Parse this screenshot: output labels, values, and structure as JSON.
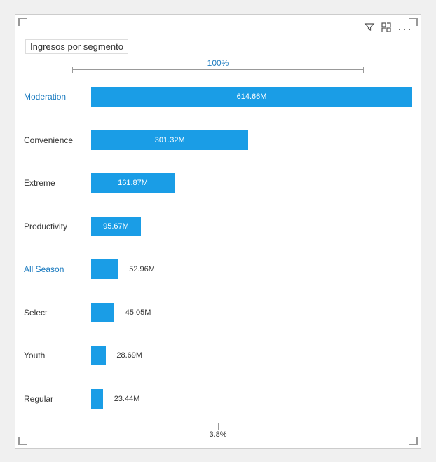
{
  "card": {
    "title": "Ingresos por segmento",
    "top_percent": "100%",
    "bottom_percent": "3.8%",
    "toolbar": {
      "filter_icon": "⊲",
      "expand_icon": "⤢",
      "more_icon": "···"
    },
    "rows": [
      {
        "label": "Moderation",
        "value": "614.66M",
        "highlight": true,
        "bar_pct": 100,
        "inside": true
      },
      {
        "label": "Convenience",
        "value": "301.32M",
        "highlight": false,
        "bar_pct": 49,
        "inside": true
      },
      {
        "label": "Extreme",
        "value": "161.87M",
        "highlight": false,
        "bar_pct": 26,
        "inside": true
      },
      {
        "label": "Productivity",
        "value": "95.67M",
        "highlight": false,
        "bar_pct": 15.5,
        "inside": true
      },
      {
        "label": "All Season",
        "value": "52.96M",
        "highlight": true,
        "bar_pct": 8.5,
        "inside": false
      },
      {
        "label": "Select",
        "value": "45.05M",
        "highlight": false,
        "bar_pct": 7.3,
        "inside": false
      },
      {
        "label": "Youth",
        "value": "28.69M",
        "highlight": false,
        "bar_pct": 4.6,
        "inside": false
      },
      {
        "label": "Regular",
        "value": "23.44M",
        "highlight": false,
        "bar_pct": 3.8,
        "inside": false
      }
    ]
  }
}
